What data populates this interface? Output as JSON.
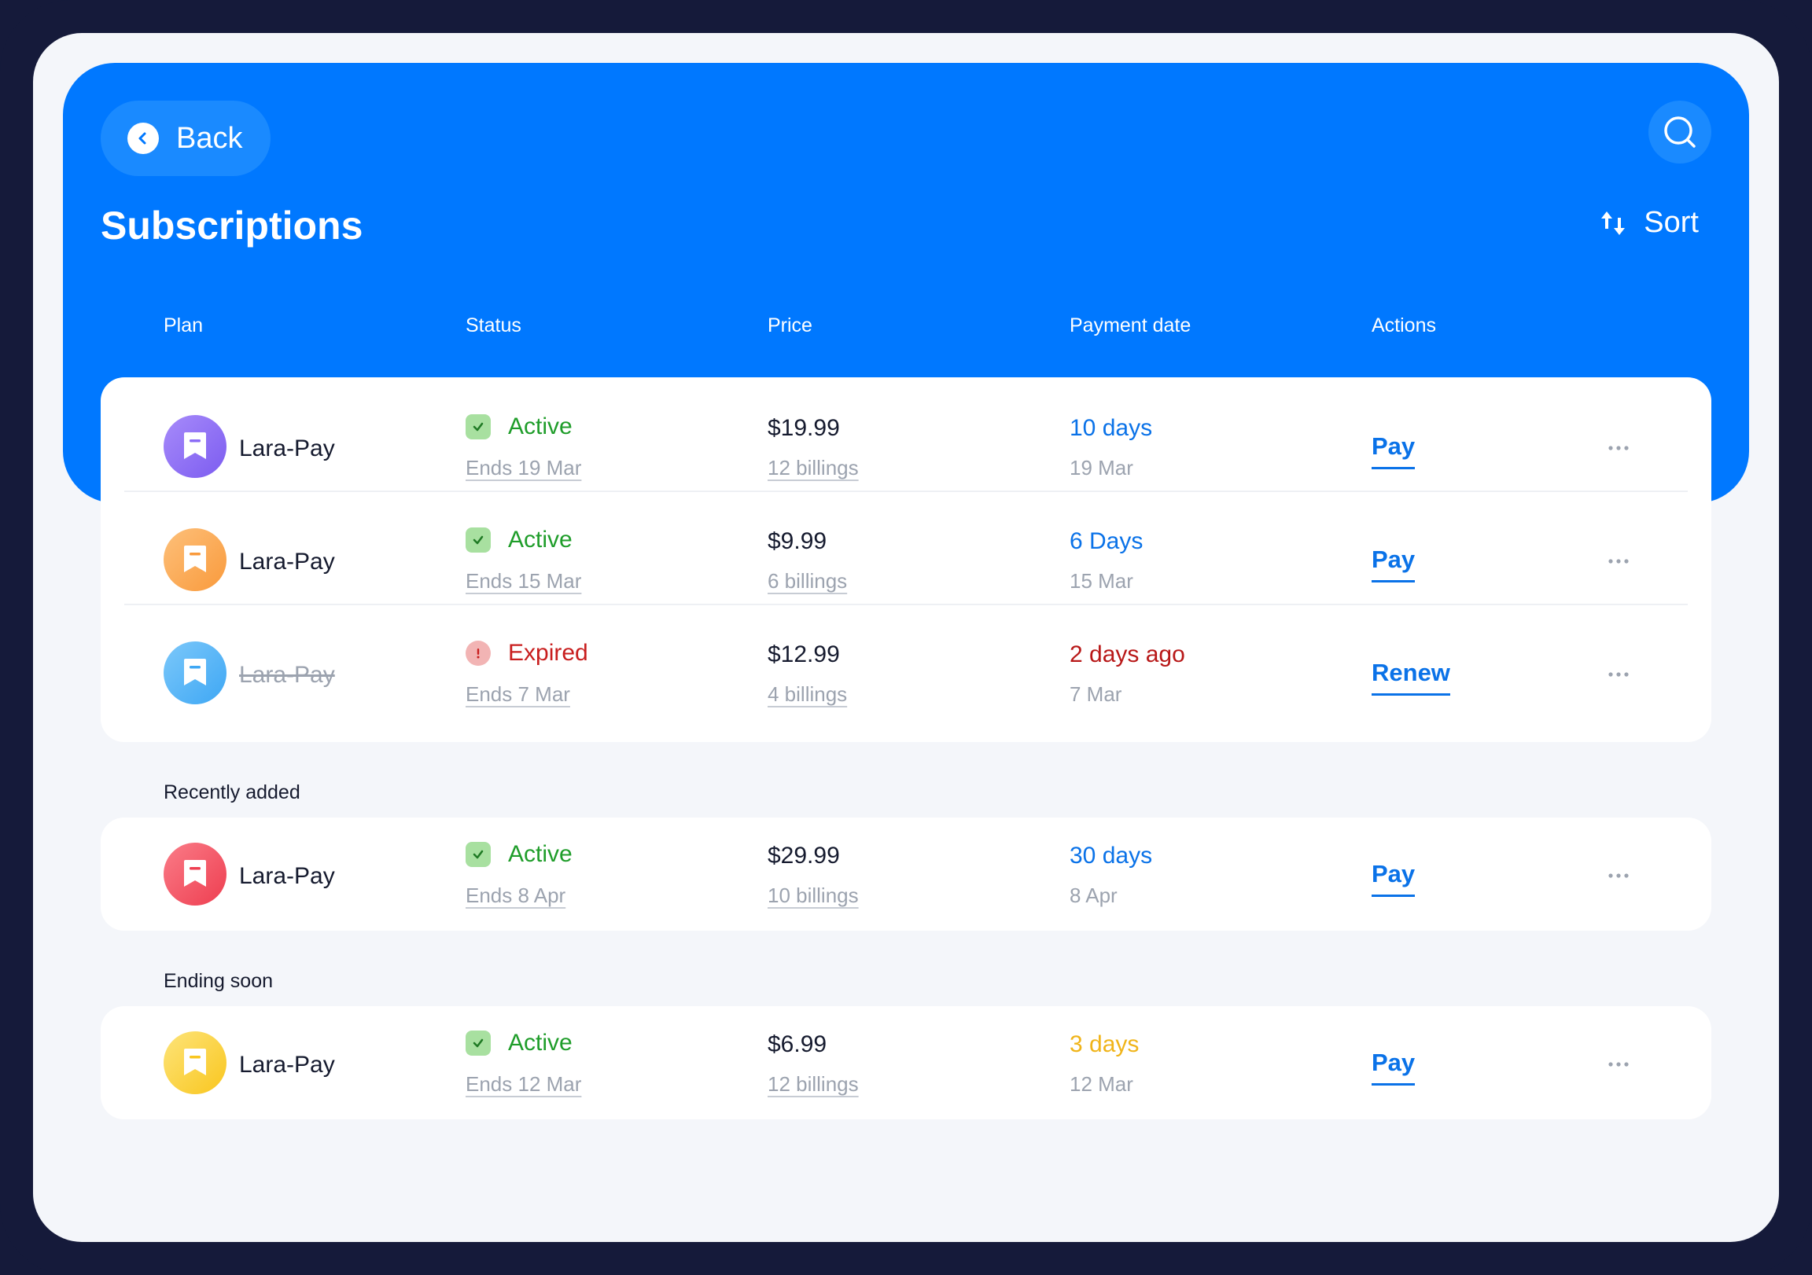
{
  "header": {
    "back_label": "Back",
    "title": "Subscriptions",
    "sort_label": "Sort"
  },
  "columns": [
    "Plan",
    "Status",
    "Price",
    "Payment date",
    "Actions"
  ],
  "sections": {
    "recent_label": "Recently added",
    "ending_label": "Ending soon"
  },
  "rows": [
    {
      "plan": "Lara-Pay",
      "status": "Active",
      "ends": "Ends 19 Mar",
      "price": "$19.99",
      "billings": "12 billings",
      "due": "10 days",
      "due_date": "19 Mar",
      "action": "Pay",
      "avatar_color": "#8b6cf6"
    },
    {
      "plan": "Lara-Pay",
      "status": "Active",
      "ends": "Ends 15 Mar",
      "price": "$9.99",
      "billings": "6 billings",
      "due": "6 Days",
      "due_date": "15 Mar",
      "action": "Pay",
      "avatar_color": "#fba84a"
    },
    {
      "plan": "Lara-Pay",
      "status": "Expired",
      "ends": "Ends 7 Mar",
      "price": "$12.99",
      "billings": "4 billings",
      "due": "2 days ago",
      "due_date": "7 Mar",
      "action": "Renew",
      "avatar_color": "#4fb3f7"
    },
    {
      "plan": "Lara-Pay",
      "status": "Active",
      "ends": "Ends 8 Apr",
      "price": "$29.99",
      "billings": "10 billings",
      "due": "30 days",
      "due_date": "8 Apr",
      "action": "Pay",
      "avatar_color": "#f04e5e"
    },
    {
      "plan": "Lara-Pay",
      "status": "Active",
      "ends": "Ends 12 Mar",
      "price": "$6.99",
      "billings": "12 billings",
      "due": "3 days",
      "due_date": "12 Mar",
      "action": "Pay",
      "avatar_color": "#fbd13c"
    }
  ],
  "icons": {
    "back": "chevron-left-icon",
    "search": "search-icon",
    "sort": "sort-icon",
    "active": "check-icon",
    "expired": "exclamation-icon",
    "more": "more-horizontal-icon",
    "plan": "bookmark-icon"
  },
  "colors": {
    "primary": "#0078ff",
    "active": "#1f9d2a",
    "expired": "#b81818",
    "warning": "#f0b419",
    "link": "#0a72e8"
  }
}
